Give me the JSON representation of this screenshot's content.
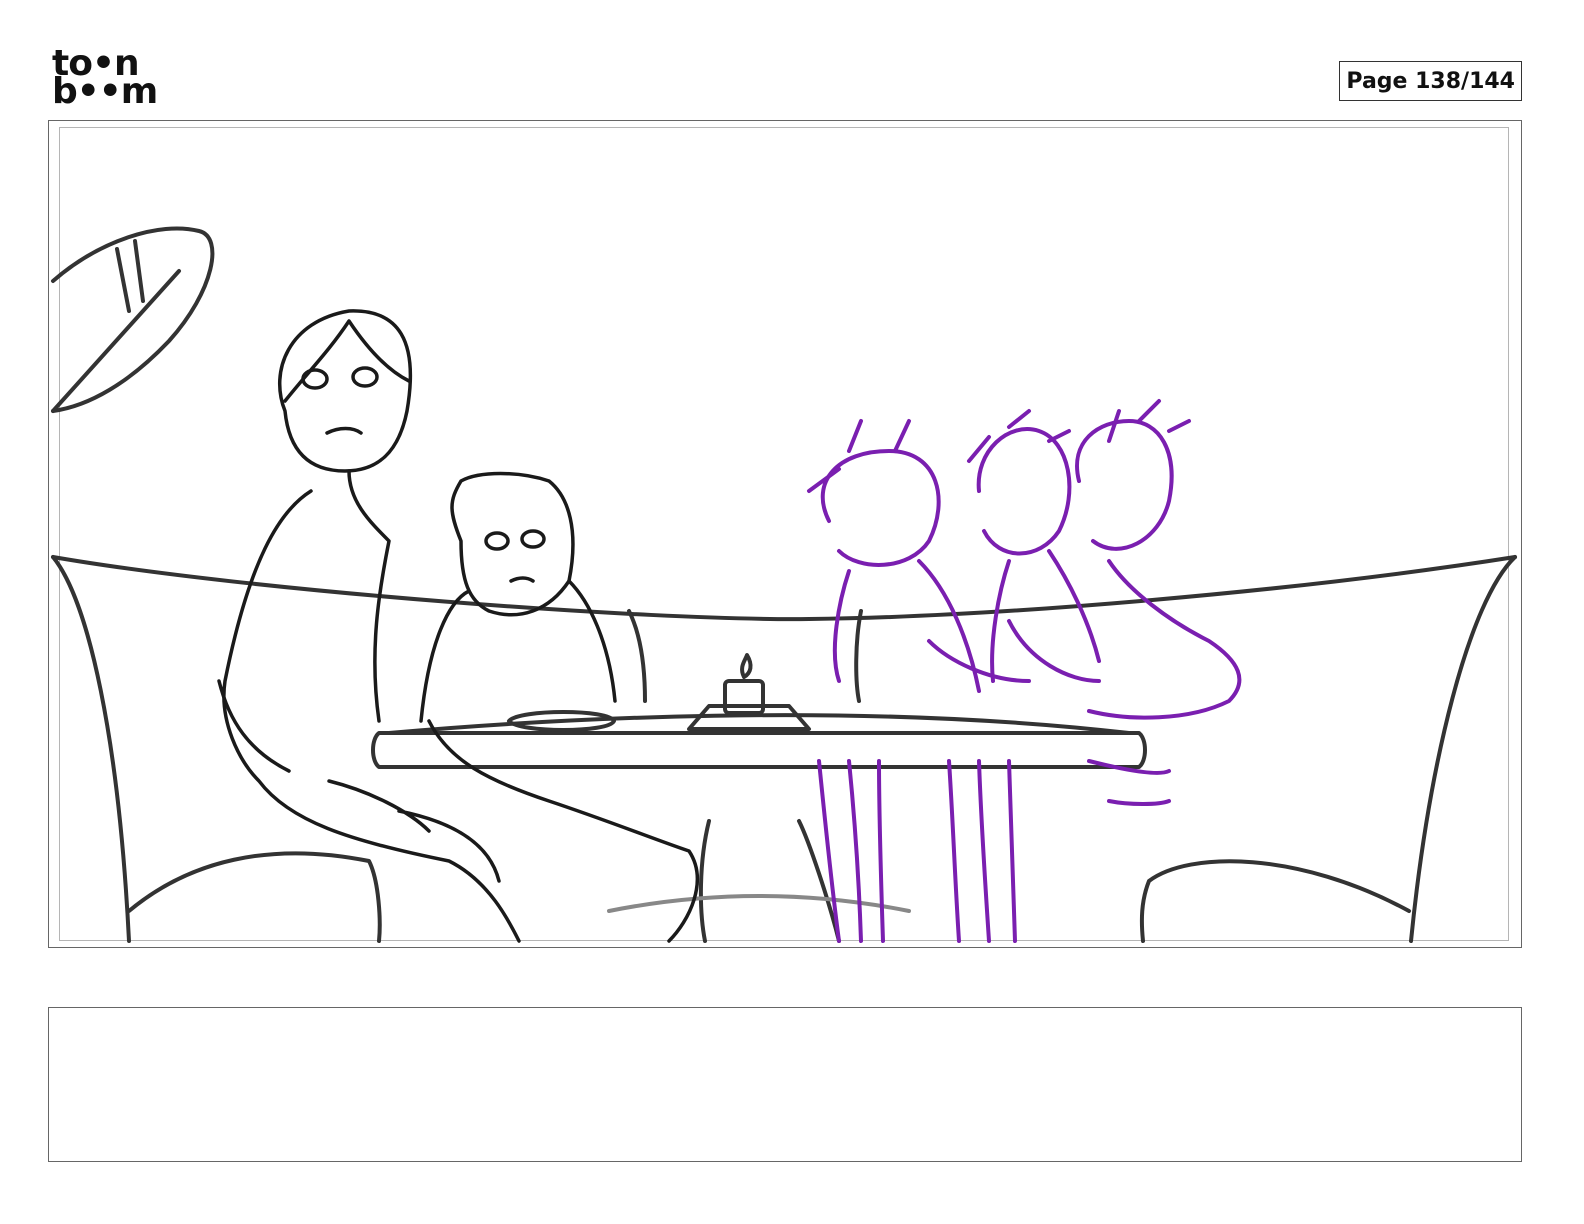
{
  "header": {
    "logo_line1": "to•n",
    "logo_line2": "b••m",
    "page_counter": "Page 138/144"
  },
  "panel": {
    "drawing_name": "storyboard-sketch"
  },
  "notes": {
    "text": ""
  },
  "colors": {
    "ink": "#1a1a1a",
    "furniture": "#333333",
    "rough_sketch": "#7a1fb0"
  }
}
